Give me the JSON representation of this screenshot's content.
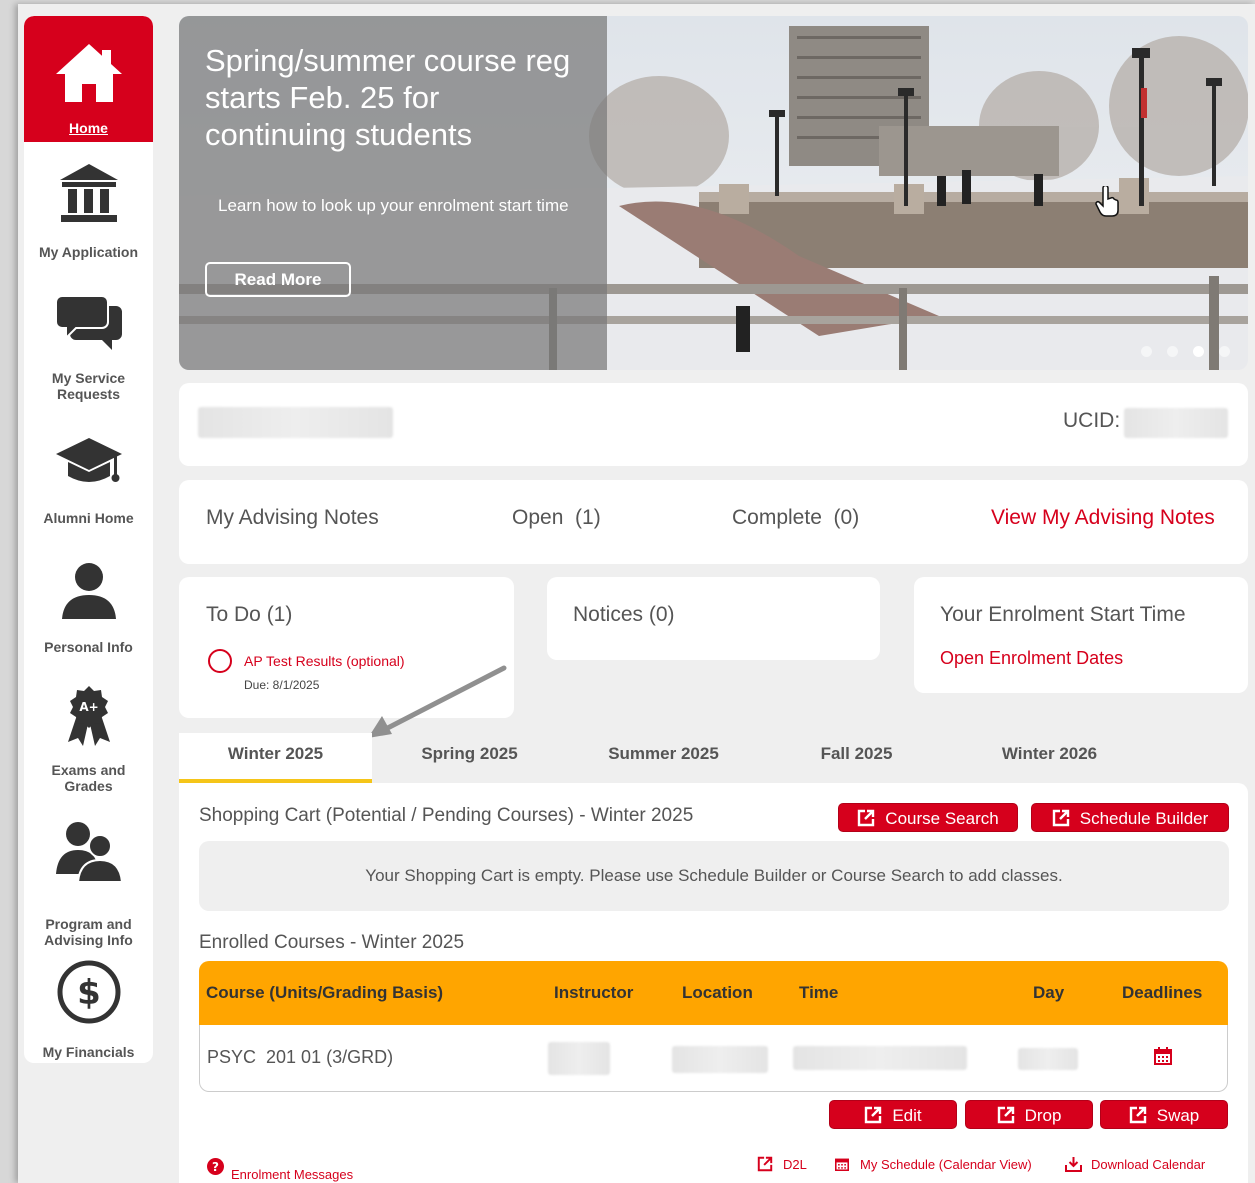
{
  "sidebar": {
    "items": [
      {
        "label": "Home",
        "icon": "home-icon",
        "active": true
      },
      {
        "label": "My Application",
        "icon": "institution-icon"
      },
      {
        "label": "My Service Requests",
        "icon": "chat-bubbles-icon"
      },
      {
        "label": "Alumni Home",
        "icon": "graduation-cap-icon"
      },
      {
        "label": "Personal Info",
        "icon": "person-icon"
      },
      {
        "label": "Exams and Grades",
        "icon": "award-ribbon-icon"
      },
      {
        "label": "Program and Advising Info",
        "icon": "people-icon"
      },
      {
        "label": "My Financials",
        "icon": "dollar-icon"
      }
    ]
  },
  "hero": {
    "title": "Spring/summer course reg starts Feb. 25 for continuing students",
    "subtitle": "Learn how to look up your enrolment start time",
    "button": "Read More",
    "slides": 4,
    "active_slide": 3
  },
  "profile": {
    "ucid_label": "UCID:"
  },
  "advising": {
    "title": "My Advising Notes",
    "open": "Open  (1)",
    "complete": "Complete  (0)",
    "link": "View My Advising Notes"
  },
  "todo": {
    "title": "To Do (1)",
    "item": "AP Test Results (optional)",
    "due": "Due: 8/1/2025"
  },
  "notices": {
    "title": "Notices (0)"
  },
  "enrolment": {
    "title": "Your Enrolment Start Time",
    "link": "Open Enrolment Dates"
  },
  "tabs": [
    "Winter 2025",
    "Spring 2025",
    "Summer 2025",
    "Fall 2025",
    "Winter 2026"
  ],
  "cart": {
    "title": "Shopping Cart (Potential / Pending Courses) - Winter 2025",
    "course_search": "Course Search",
    "schedule_builder": "Schedule Builder",
    "empty_message": "Your Shopping Cart is empty. Please use Schedule Builder or Course Search to add classes."
  },
  "enrolled": {
    "title": "Enrolled Courses - Winter 2025",
    "columns": [
      "Course (Units/Grading Basis)",
      "Instructor",
      "Location",
      "Time",
      "Day",
      "Deadlines"
    ],
    "rows": [
      {
        "course": "PSYC  201 01 (3/GRD)"
      }
    ]
  },
  "actions": {
    "edit": "Edit",
    "drop": "Drop",
    "swap": "Swap"
  },
  "footer": {
    "messages": "Enrolment Messages",
    "d2l": "D2L",
    "schedule": "My Schedule (Calendar View)",
    "download": "Download Calendar"
  },
  "colors": {
    "accent": "#d6001c",
    "table_header": "#ffa500",
    "tab_underline": "#f5c518"
  }
}
